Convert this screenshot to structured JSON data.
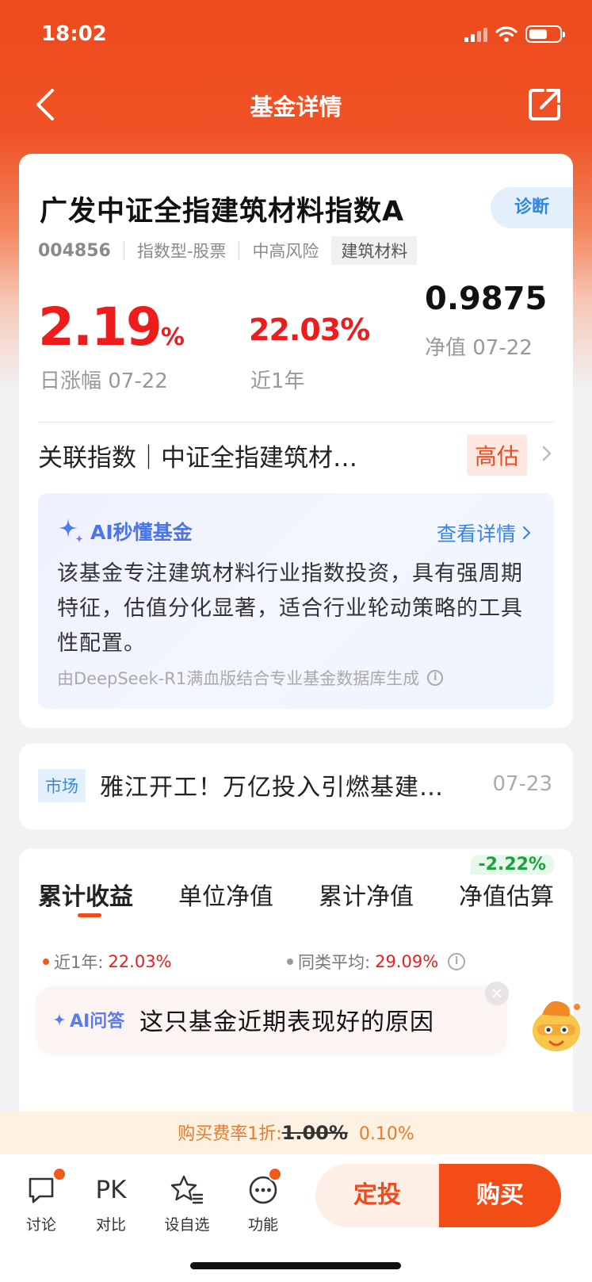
{
  "status": {
    "time": "18:02"
  },
  "nav": {
    "title": "基金详情"
  },
  "fund": {
    "name": "广发中证全指建筑材料指数A",
    "diagnose_label": "诊断",
    "code": "004856",
    "type": "指数型-股票",
    "risk": "中高风险",
    "sector": "建筑材料",
    "day_change": "2.19",
    "day_change_unit": "%",
    "day_change_label": "日涨幅 07-22",
    "year_return": "22.03%",
    "year_return_label": "近1年",
    "nav_value": "0.9875",
    "nav_label": "净值 07-22"
  },
  "index_link": {
    "text": "关联指数｜中证全指建筑材…",
    "badge": "高估"
  },
  "ai_summary": {
    "title": "AI秒懂基金",
    "link": "查看详情",
    "description": "该基金专注建筑材料行业指数投资，具有强周期特征，估值分化显著，适合行业轮动策略的工具性配置。",
    "footer": "由DeepSeek-R1满血版结合专业基金数据库生成"
  },
  "news": {
    "badge": "市场",
    "title": "雅江开工！万亿投入引燃基建…",
    "date": "07-23"
  },
  "chart": {
    "tabs": [
      "累计收益",
      "单位净值",
      "累计净值",
      "净值估算"
    ],
    "estimate_badge": "-2.22%",
    "legend": [
      {
        "label": "近1年:",
        "value": "22.03%",
        "color": "#f25a1d"
      },
      {
        "label": "同类平均:",
        "value": "29.09%",
        "color": "#999999"
      }
    ]
  },
  "ai_ask": {
    "tag": "AI问答",
    "question": "这只基金近期表现好的原因"
  },
  "promo": {
    "prefix": "购买费率1折:",
    "original": "1.00%",
    "discounted": "0.10%"
  },
  "bottom": {
    "items": [
      {
        "label": "讨论",
        "icon": "chat-bubble-icon"
      },
      {
        "label": "对比",
        "icon_text": "PK"
      },
      {
        "label": "设自选",
        "icon": "star-list-icon"
      },
      {
        "label": "功能",
        "icon": "more-dots-icon"
      }
    ],
    "dingtou_label": "定投",
    "buy_label": "购买"
  },
  "colors": {
    "brand": "#ee4a1c",
    "rise": "#ee1c1c",
    "fall": "#1aa23d",
    "ai_blue": "#4a74e8"
  }
}
